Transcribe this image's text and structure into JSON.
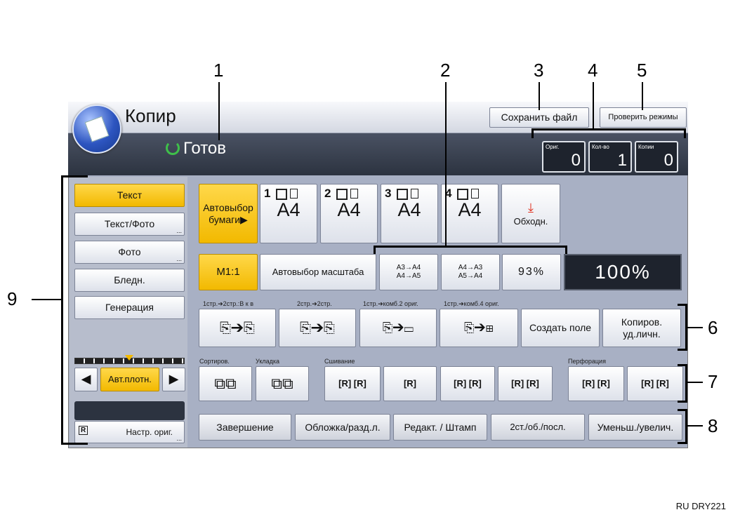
{
  "app": {
    "title": "Копир"
  },
  "status": {
    "text": "Готов"
  },
  "header_buttons": {
    "save_file": "Сохранить файл",
    "check_modes": "Проверить режимы"
  },
  "counters": [
    {
      "label": "Ориг.",
      "value": "0"
    },
    {
      "label": "Кол-во",
      "value": "1"
    },
    {
      "label": "Копии",
      "value": "0"
    }
  ],
  "original_types": [
    "Текст",
    "Текст/Фото",
    "Фото",
    "Бледн.",
    "Генерация"
  ],
  "density": {
    "label": "Авт.плотн."
  },
  "original_settings": {
    "label": "Настр. ориг."
  },
  "paper": {
    "auto_label": "Автовыбор бумаги▶",
    "trays": [
      {
        "num": "1",
        "size": "A4"
      },
      {
        "num": "2",
        "size": "A4"
      },
      {
        "num": "3",
        "size": "A4"
      },
      {
        "num": "4",
        "size": "A4"
      }
    ],
    "bypass": "Обходн."
  },
  "scale": {
    "m11": "M1:1",
    "auto": "Автовыбор масштаба",
    "preset1": "A3→A4 A4→A5",
    "preset2": "A4→A3 A5→A4",
    "preset3": "93%",
    "current": "100%"
  },
  "duplex": {
    "captions": [
      "1стр.➔2стр.:В к в",
      "2стр.➔2стр.",
      "1стр.➔комб.2 ориг.",
      "1стр.➔комб.4 ориг."
    ],
    "create_margin": "Создать поле",
    "id_copy": "Копиров. уд.личн."
  },
  "finishing": {
    "captions": {
      "sort": "Сортиров.",
      "stack": "Укладка",
      "staple": "Сшивание",
      "punch": "Перфорация"
    }
  },
  "bottom_tabs": [
    "Завершение",
    "Обложка/разд.л.",
    "Редакт. / Штамп",
    "2ст./об./посл.",
    "Уменьш./увелич."
  ],
  "callouts": [
    "1",
    "2",
    "3",
    "4",
    "5",
    "6",
    "7",
    "8",
    "9"
  ],
  "footer": {
    "code": "RU DRY221"
  },
  "colors": {
    "accent": "#f2b900",
    "status_ok": "#3fc04a",
    "panel": "#a8b0c4",
    "dark": "#1e232d"
  }
}
